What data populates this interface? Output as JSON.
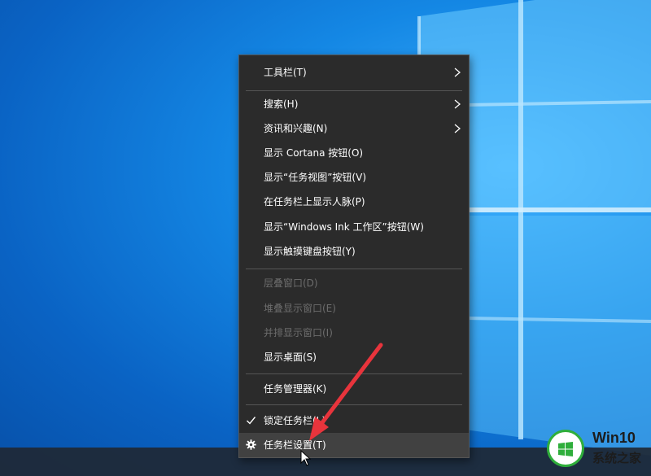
{
  "menu": {
    "items": [
      {
        "label": "工具栏(T)",
        "submenu": true,
        "enabled": true
      },
      {
        "label": "搜索(H)",
        "submenu": true,
        "enabled": true
      },
      {
        "label": "资讯和兴趣(N)",
        "submenu": true,
        "enabled": true
      },
      {
        "label": "显示 Cortana 按钮(O)",
        "enabled": true
      },
      {
        "label": "显示“任务视图”按钮(V)",
        "enabled": true
      },
      {
        "label": "在任务栏上显示人脉(P)",
        "enabled": true
      },
      {
        "label": "显示“Windows Ink 工作区”按钮(W)",
        "enabled": true
      },
      {
        "label": "显示触摸键盘按钮(Y)",
        "enabled": true
      },
      {
        "label": "层叠窗口(D)",
        "enabled": false
      },
      {
        "label": "堆叠显示窗口(E)",
        "enabled": false
      },
      {
        "label": "并排显示窗口(I)",
        "enabled": false
      },
      {
        "label": "显示桌面(S)",
        "enabled": true
      },
      {
        "label": "任务管理器(K)",
        "enabled": true
      },
      {
        "label": "锁定任务栏(L)",
        "checked": true,
        "enabled": true
      },
      {
        "label": "任务栏设置(T)",
        "icon": "gear-icon",
        "enabled": true,
        "hovered": true
      }
    ]
  },
  "watermark": {
    "line1": "Win10",
    "line2": "系统之家"
  },
  "colors": {
    "menu_bg": "#2b2b2b",
    "menu_text": "#ffffff",
    "disabled_text": "#6d6d6d",
    "hover_bg": "#414141",
    "arrow": "#e8343c",
    "desktop": "#1487e4"
  }
}
